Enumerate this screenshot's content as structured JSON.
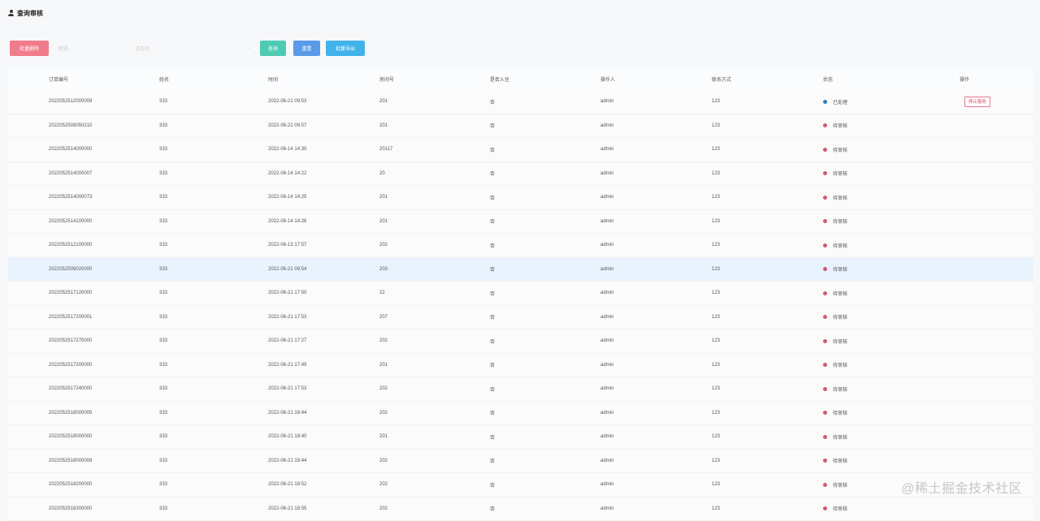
{
  "header": {
    "title": "查询审核"
  },
  "toolbar": {
    "batch_delete_label": "批量删除",
    "filter_label": "状态",
    "select_placeholder": "请选择",
    "search_label": "查询",
    "reset_label": "重置",
    "export_label": "批量导出"
  },
  "table": {
    "columns": [
      "订单编号",
      "姓名",
      "时间",
      "房间号",
      "是否入住",
      "操作人",
      "联系方式",
      "状态",
      "操作"
    ],
    "rows": [
      {
        "id": "2022052512000009",
        "name": "333",
        "time": "2022-06-21 09:53",
        "room": "201",
        "checked_in": "否",
        "operator": "admin",
        "phone": "123",
        "status": "已处理",
        "status_color": "#2d7fbf",
        "action": "停止服务"
      },
      {
        "id": "2022052509050210",
        "name": "333",
        "time": "2022-06-21 09:57",
        "room": "201",
        "checked_in": "否",
        "operator": "admin",
        "phone": "123",
        "status": "待审核",
        "status_color": "#d45a6a",
        "action": ""
      },
      {
        "id": "2022052514000000",
        "name": "333",
        "time": "2022-06-14 14:30",
        "room": "20117",
        "checked_in": "否",
        "operator": "admin",
        "phone": "123",
        "status": "待审核",
        "status_color": "#d45a6a",
        "action": ""
      },
      {
        "id": "2022052514000007",
        "name": "333",
        "time": "2022-06-14 14:22",
        "room": "20",
        "checked_in": "否",
        "operator": "admin",
        "phone": "123",
        "status": "待审核",
        "status_color": "#d45a6a",
        "action": ""
      },
      {
        "id": "2022052514000073",
        "name": "333",
        "time": "2022-06-14 14:25",
        "room": "201",
        "checked_in": "否",
        "operator": "admin",
        "phone": "123",
        "status": "待审核",
        "status_color": "#d45a6a",
        "action": ""
      },
      {
        "id": "2022052514100000",
        "name": "333",
        "time": "2022-06-14 14:26",
        "room": "201",
        "checked_in": "否",
        "operator": "admin",
        "phone": "123",
        "status": "待审核",
        "status_color": "#d45a6a",
        "action": ""
      },
      {
        "id": "2022052512100000",
        "name": "333",
        "time": "2022-06-13 17:57",
        "room": "202",
        "checked_in": "否",
        "operator": "admin",
        "phone": "123",
        "status": "待审核",
        "status_color": "#d45a6a",
        "action": ""
      },
      {
        "id": "2022052509020000",
        "name": "333",
        "time": "2022-06-21 09:54",
        "room": "203",
        "checked_in": "否",
        "operator": "admin",
        "phone": "123",
        "status": "待审核",
        "status_color": "#d45a6a",
        "action": ""
      },
      {
        "id": "2022052517120000",
        "name": "333",
        "time": "2022-06-21 17:50",
        "room": "22",
        "checked_in": "否",
        "operator": "admin",
        "phone": "123",
        "status": "待审核",
        "status_color": "#d45a6a",
        "action": ""
      },
      {
        "id": "2022052517200001",
        "name": "333",
        "time": "2022-06-21 17:53",
        "room": "207",
        "checked_in": "否",
        "operator": "admin",
        "phone": "123",
        "status": "待审核",
        "status_color": "#d45a6a",
        "action": ""
      },
      {
        "id": "2022052517270000",
        "name": "333",
        "time": "2022-06-21 17:27",
        "room": "202",
        "checked_in": "否",
        "operator": "admin",
        "phone": "123",
        "status": "待审核",
        "status_color": "#d45a6a",
        "action": ""
      },
      {
        "id": "2022052517200000",
        "name": "333",
        "time": "2022-06-21 17:49",
        "room": "201",
        "checked_in": "否",
        "operator": "admin",
        "phone": "123",
        "status": "待审核",
        "status_color": "#d45a6a",
        "action": ""
      },
      {
        "id": "2022052517240000",
        "name": "333",
        "time": "2022-06-21 17:53",
        "room": "202",
        "checked_in": "否",
        "operator": "admin",
        "phone": "123",
        "status": "待审核",
        "status_color": "#d45a6a",
        "action": ""
      },
      {
        "id": "2022052518000005",
        "name": "333",
        "time": "2022-06-21 18:44",
        "room": "202",
        "checked_in": "否",
        "operator": "admin",
        "phone": "123",
        "status": "待审核",
        "status_color": "#d45a6a",
        "action": ""
      },
      {
        "id": "2022052518000000",
        "name": "333",
        "time": "2022-06-21 18:40",
        "room": "201",
        "checked_in": "否",
        "operator": "admin",
        "phone": "123",
        "status": "待审核",
        "status_color": "#d45a6a",
        "action": ""
      },
      {
        "id": "2022052518000008",
        "name": "333",
        "time": "2022-06-21 18:44",
        "room": "202",
        "checked_in": "否",
        "operator": "admin",
        "phone": "123",
        "status": "待审核",
        "status_color": "#d45a6a",
        "action": ""
      },
      {
        "id": "2022052518200000",
        "name": "333",
        "time": "2022-06-21 18:52",
        "room": "202",
        "checked_in": "否",
        "operator": "admin",
        "phone": "123",
        "status": "待审核",
        "status_color": "#d45a6a",
        "action": ""
      },
      {
        "id": "2022052518300000",
        "name": "333",
        "time": "2022-06-21 18:55",
        "room": "202",
        "checked_in": "否",
        "operator": "admin",
        "phone": "123",
        "status": "待审核",
        "status_color": "#d45a6a",
        "action": ""
      }
    ],
    "highlight_row": 7
  },
  "watermark": "@稀土掘金技术社区"
}
